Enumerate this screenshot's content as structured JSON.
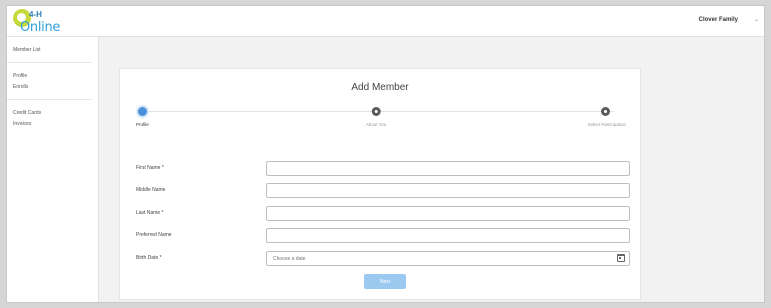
{
  "app": {
    "logo_text_top": "4-H",
    "logo_text_bottom": "Online"
  },
  "header": {
    "user_name": "Clover Family",
    "chevron_icon": "chevron-down-icon"
  },
  "sidebar": {
    "groups": [
      {
        "items": [
          {
            "label": "Member List"
          }
        ]
      },
      {
        "items": [
          {
            "label": "Profile"
          },
          {
            "label": "Enrolls"
          }
        ]
      },
      {
        "items": [
          {
            "label": "Credit Cards"
          },
          {
            "label": "Invoices"
          }
        ]
      }
    ]
  },
  "form": {
    "title": "Add Member",
    "steps": [
      {
        "label": "Profile",
        "state": "active"
      },
      {
        "label": "About You",
        "state": "pending"
      },
      {
        "label": "Select Participation",
        "state": "pending"
      }
    ],
    "fields": [
      {
        "label": "First Name *",
        "value": "",
        "placeholder": ""
      },
      {
        "label": "Middle Name",
        "value": "",
        "placeholder": ""
      },
      {
        "label": "Last Name *",
        "value": "",
        "placeholder": ""
      },
      {
        "label": "Preferred Name",
        "value": "",
        "placeholder": ""
      }
    ],
    "birth_date": {
      "label": "Birth Date *",
      "placeholder": "Choose a date",
      "icon": "calendar-icon"
    },
    "next_label": "Next"
  },
  "colors": {
    "accent": "#4a90d9",
    "button": "#9cc9f0",
    "logo_green": "#c6d93b",
    "logo_blue": "#2f9fd9"
  }
}
